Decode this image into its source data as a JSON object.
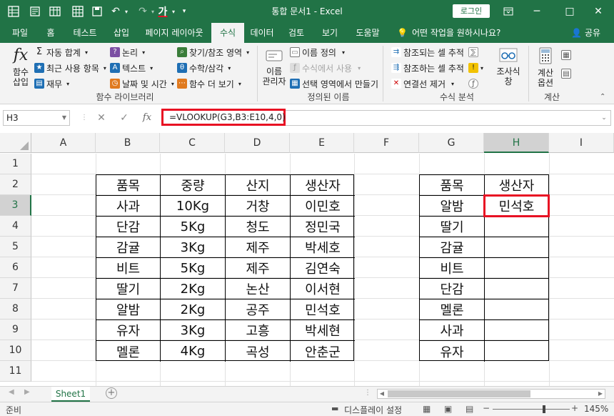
{
  "titlebar": {
    "title": "통합 문서1  -  Excel",
    "login": "로그인",
    "font_icon_glyph": "가",
    "minimize_glyph": "─",
    "restore_glyph": "▭",
    "maximize_glyph": "□",
    "close_glyph": "✕"
  },
  "tabs": [
    "파일",
    "홈",
    "테스트",
    "삽입",
    "페이지 레이아웃",
    "수식",
    "데이터",
    "검토",
    "보기",
    "도움말"
  ],
  "active_tab": "수식",
  "tell_me": "어떤 작업을 원하시나요?",
  "share": "공유",
  "ribbon": {
    "function_library": {
      "insert_function": [
        "함수",
        "삽입"
      ],
      "autosum": "자동 합계",
      "recent": "최근 사용 항목",
      "financial": "재무",
      "logical": "논리",
      "text": "텍스트",
      "datetime": "날짜 및 시간",
      "lookup": "찾기/참조 영역",
      "math": "수학/삼각",
      "more": "함수 더 보기",
      "label": "함수 라이브러리"
    },
    "defined_names": {
      "name_manager": [
        "이름",
        "관리자"
      ],
      "define_name": "이름 정의",
      "use_in_formula": "수식에서 사용",
      "create_from_selection": "선택 영역에서 만들기",
      "label": "정의된 이름"
    },
    "formula_auditing": {
      "trace_precedents": "참조되는 셀 추적",
      "trace_dependents": "참조하는 셀 추적",
      "remove_arrows": "연결선 제거",
      "watch_window": [
        "조사식",
        "창"
      ],
      "label": "수식 분석"
    },
    "calculation": {
      "options": [
        "계산",
        "옵션"
      ],
      "label": "계산"
    }
  },
  "formula_bar": {
    "name_box": "H3",
    "cancel_glyph": "✕",
    "enter_glyph": "✓",
    "fx": "fx",
    "formula": "=VLOOKUP(G3,B3:E10,4,0)"
  },
  "columns": [
    "A",
    "B",
    "C",
    "D",
    "E",
    "F",
    "G",
    "H",
    "I"
  ],
  "rows": [
    "1",
    "2",
    "3",
    "4",
    "5",
    "6",
    "7",
    "8",
    "9",
    "10",
    "11"
  ],
  "table1": {
    "headers": [
      "품목",
      "중량",
      "산지",
      "생산자"
    ],
    "rows": [
      [
        "사과",
        "10Kg",
        "거창",
        "이민호"
      ],
      [
        "단감",
        "5Kg",
        "청도",
        "정민국"
      ],
      [
        "감귤",
        "3Kg",
        "제주",
        "박세호"
      ],
      [
        "비트",
        "5Kg",
        "제주",
        "김연숙"
      ],
      [
        "딸기",
        "2Kg",
        "논산",
        "이서현"
      ],
      [
        "알밤",
        "2Kg",
        "공주",
        "민석호"
      ],
      [
        "유자",
        "3Kg",
        "고흥",
        "박세현"
      ],
      [
        "멜론",
        "4Kg",
        "곡성",
        "안춘군"
      ]
    ]
  },
  "table2": {
    "headers": [
      "품목",
      "생산자"
    ],
    "items": [
      "알밤",
      "딸기",
      "감귤",
      "비트",
      "단감",
      "멜론",
      "사과",
      "유자"
    ],
    "results": [
      "민석호",
      "",
      "",
      "",
      "",
      "",
      "",
      ""
    ]
  },
  "sheet_tab": "Sheet1",
  "status": {
    "ready": "준비",
    "display_settings": "디스플레이 설정",
    "zoom": "145%"
  },
  "colors": {
    "excel_green": "#217346",
    "highlight_red": "#e81123"
  }
}
